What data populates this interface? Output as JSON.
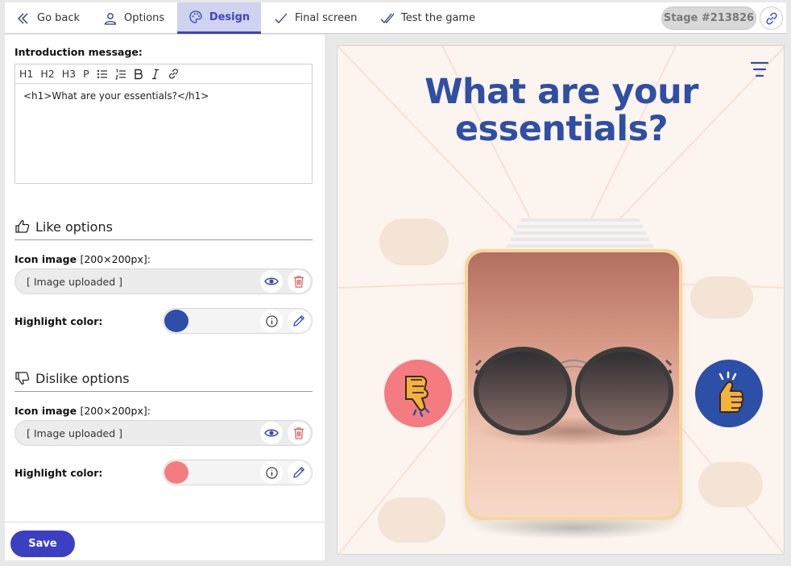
{
  "nav": {
    "items": [
      {
        "label": "Go back",
        "icon": "double-chevron-left-icon"
      },
      {
        "label": "Options",
        "icon": "user-settings-icon"
      },
      {
        "label": "Design",
        "icon": "palette-icon",
        "active": true
      },
      {
        "label": "Final screen",
        "icon": "check-icon"
      },
      {
        "label": "Test the game",
        "icon": "double-check-icon"
      }
    ],
    "stage": "Stage #213826"
  },
  "intro": {
    "label": "Introduction message:",
    "toolbar": [
      "H1",
      "H2",
      "H3",
      "P"
    ],
    "content": "<h1>What are your essentials?</h1>"
  },
  "like": {
    "title": "Like options",
    "icon_label": "Icon image",
    "icon_size": "[200×200px]:",
    "upload_text": "[ Image uploaded ]",
    "highlight_label": "Highlight color:",
    "color": "#2c4fa8"
  },
  "dislike": {
    "title": "Dislike options",
    "icon_label": "Icon image",
    "icon_size": "[200×200px]:",
    "upload_text": "[ Image uploaded ]",
    "highlight_label": "Highlight color:",
    "color": "#f47c80"
  },
  "save_label": "Save",
  "preview": {
    "headline_1": "What are your",
    "headline_2": "essentials?"
  },
  "colors": {
    "accent": "#3b44c4",
    "headline": "#2e4fa3",
    "like_bg": "#2c4fa8",
    "dislike_bg": "#f47c80"
  }
}
